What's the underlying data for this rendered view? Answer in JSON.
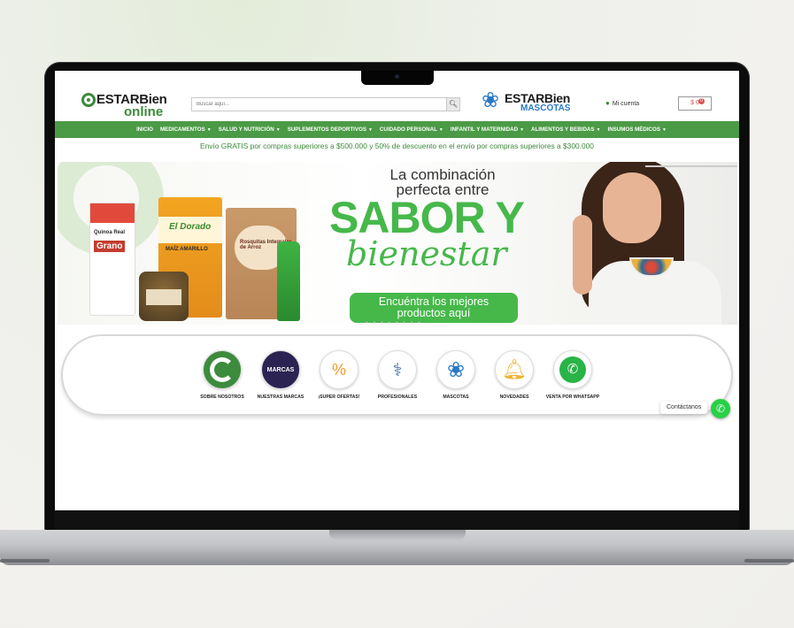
{
  "header": {
    "logo_top": "ESTARBien",
    "logo_bottom": "online",
    "search_placeholder": "Buscar aquí...",
    "mascotas_logo_top": "ESTARBien",
    "mascotas_logo_bottom": "MASCOTAS",
    "account_label": "Mi cuenta",
    "cart_label": "$ 0",
    "cart_count": "0"
  },
  "nav": {
    "items": [
      {
        "label": "INICIO",
        "dropdown": false
      },
      {
        "label": "MEDICAMENTOS",
        "dropdown": true
      },
      {
        "label": "SALUD Y NUTRICIÓN",
        "dropdown": true
      },
      {
        "label": "SUPLEMENTOS DEPORTIVOS",
        "dropdown": true
      },
      {
        "label": "CUIDADO PERSONAL",
        "dropdown": true
      },
      {
        "label": "INFANTIL Y MATERNIDAD",
        "dropdown": true
      },
      {
        "label": "ALIMENTOS Y BEBIDAS",
        "dropdown": true
      },
      {
        "label": "INSUMOS MÉDICOS",
        "dropdown": true
      }
    ]
  },
  "promo_text": "Envío GRATIS por compras superiores a $500.000 y 50% de descuento en el envío por compras superiores a $300.000",
  "banner": {
    "line1": "La combinación perfecta entre",
    "line2": "SABOR Y",
    "line3": "bienestar",
    "cta_line1": "Encuéntra los mejores",
    "cta_line2": "productos aquí",
    "products": {
      "p1_brand": "Andean Valley",
      "p1_name": "Quinoa Real",
      "p1_big": "Grano",
      "p2_brand": "El Dorado",
      "p2_name": "MAÍZ AMARILLO",
      "p3_name": "Rosquitas Integrales de Arroz"
    }
  },
  "categories": [
    {
      "label": "SOBRE NOSOTROS",
      "icon": "swirl-logo-icon"
    },
    {
      "label": "NUESTRAS MARCAS",
      "icon": "marcas-icon",
      "icon_text": "MARCAS"
    },
    {
      "label": "¡SUPER OFERTAS!",
      "icon": "discount-tag-icon"
    },
    {
      "label": "PROFESIONALES",
      "icon": "doctor-icon"
    },
    {
      "label": "MASCOTAS",
      "icon": "paw-icon"
    },
    {
      "label": "NOVEDADES",
      "icon": "bell-icon"
    },
    {
      "label": "VENTA POR WHATSAPP",
      "icon": "whatsapp-icon"
    }
  ],
  "whatsapp_chip": "Contáctanos",
  "colors": {
    "brand_green": "#4b9a46",
    "accent_green": "#46b84a",
    "mascotas_blue": "#2a79c5",
    "cart_red": "#d9534f"
  }
}
